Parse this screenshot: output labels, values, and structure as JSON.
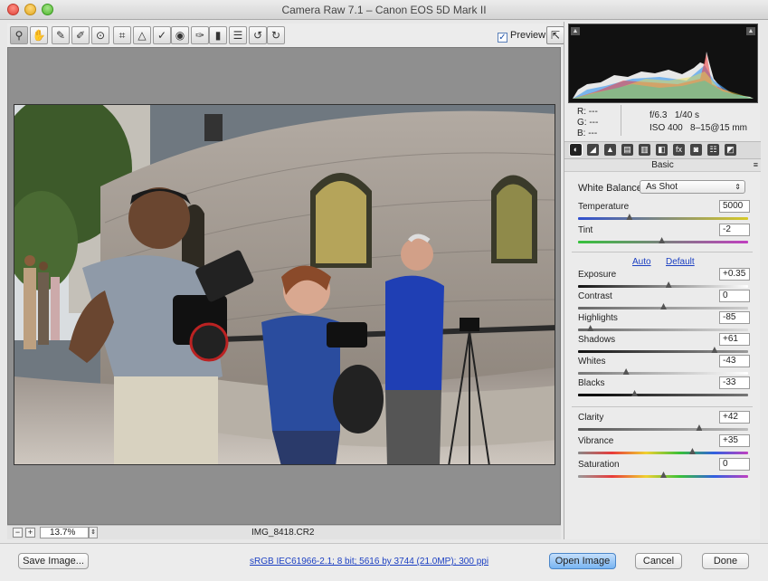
{
  "window": {
    "title": "Camera Raw 7.1  –  Canon EOS 5D Mark II"
  },
  "toolbar": {
    "tools": [
      {
        "name": "zoom-tool-icon",
        "glyph": "⚲"
      },
      {
        "name": "hand-tool-icon",
        "glyph": "✋"
      },
      {
        "name": "white-balance-tool-icon",
        "glyph": "✎"
      },
      {
        "name": "color-sampler-tool-icon",
        "glyph": "✐"
      },
      {
        "name": "targeted-adjustment-tool-icon",
        "glyph": "⊙"
      },
      {
        "name": "crop-tool-icon",
        "glyph": "⌗"
      },
      {
        "name": "straighten-tool-icon",
        "glyph": "△"
      },
      {
        "name": "spot-removal-tool-icon",
        "glyph": "✓"
      },
      {
        "name": "red-eye-tool-icon",
        "glyph": "◉"
      },
      {
        "name": "adjustment-brush-icon",
        "glyph": "✑"
      },
      {
        "name": "graduated-filter-icon",
        "glyph": "▮"
      },
      {
        "name": "preferences-icon",
        "glyph": "☰"
      },
      {
        "name": "rotate-ccw-icon",
        "glyph": "↺"
      },
      {
        "name": "rotate-cw-icon",
        "glyph": "↻"
      }
    ],
    "preview_label": "Preview",
    "preview_checked": "✓",
    "fullscreen_glyph": "⇱"
  },
  "status": {
    "zoom_minus": "−",
    "zoom_plus": "+",
    "zoom_value": "13.7%",
    "zoom_arrow": "⇕",
    "filename": "IMG_8418.CR2"
  },
  "readout": {
    "r": "R:  ---",
    "g": "G:  ---",
    "b": "B:  ---",
    "aperture": "f/6.3",
    "shutter": "1/40 s",
    "iso": "ISO 400",
    "lens": "8–15@15 mm"
  },
  "panel": {
    "section_title": "Basic",
    "section_menu": "≡",
    "tabs": [
      "◐",
      "◢",
      "▲",
      "▤",
      "▥",
      "◧",
      "fx",
      "◙",
      "☷",
      "◩"
    ],
    "white_balance_label": "White Balance:",
    "white_balance_value": "As Shot",
    "auto_label": "Auto",
    "default_label": "Default",
    "controls": [
      {
        "label": "Temperature",
        "value": "5000",
        "pos": 0.3,
        "track": "linear-gradient(90deg,#2f4fd0,#d6c928)"
      },
      {
        "label": "Tint",
        "value": "-2",
        "pos": 0.49,
        "track": "linear-gradient(90deg,#36c23c,#c03fc0)"
      },
      {
        "label": "Exposure",
        "value": "+0.35",
        "pos": 0.53,
        "track": "linear-gradient(90deg,#111,#fff)"
      },
      {
        "label": "Contrast",
        "value": "0",
        "pos": 0.5,
        "track": "linear-gradient(90deg,#666,#ccc)"
      },
      {
        "label": "Highlights",
        "value": "-85",
        "pos": 0.07,
        "track": "linear-gradient(90deg,#666,#ddd)"
      },
      {
        "label": "Shadows",
        "value": "+61",
        "pos": 0.8,
        "track": "linear-gradient(90deg,#111,#999)"
      },
      {
        "label": "Whites",
        "value": "-43",
        "pos": 0.28,
        "track": "linear-gradient(90deg,#777,#fff)"
      },
      {
        "label": "Blacks",
        "value": "-33",
        "pos": 0.33,
        "track": "linear-gradient(90deg,#000,#777)"
      },
      {
        "label": "Clarity",
        "value": "+42",
        "pos": 0.71,
        "track": "linear-gradient(90deg,#555,#bbb)"
      },
      {
        "label": "Vibrance",
        "value": "+35",
        "pos": 0.67,
        "track": "linear-gradient(90deg,#888,#e83a3a,#f0d030,#38c038,#3060e0,#c040c0)"
      },
      {
        "label": "Saturation",
        "value": "0",
        "pos": 0.5,
        "track": "linear-gradient(90deg,#999,#e83a3a,#f0d030,#38c038,#3060e0,#c040c0)"
      }
    ]
  },
  "bottom": {
    "save_label": "Save Image...",
    "workflow_link": "sRGB IEC61966-2.1; 8 bit; 5616 by 3744 (21.0MP); 300 ppi",
    "open_label": "Open Image",
    "cancel_label": "Cancel",
    "done_label": "Done"
  }
}
